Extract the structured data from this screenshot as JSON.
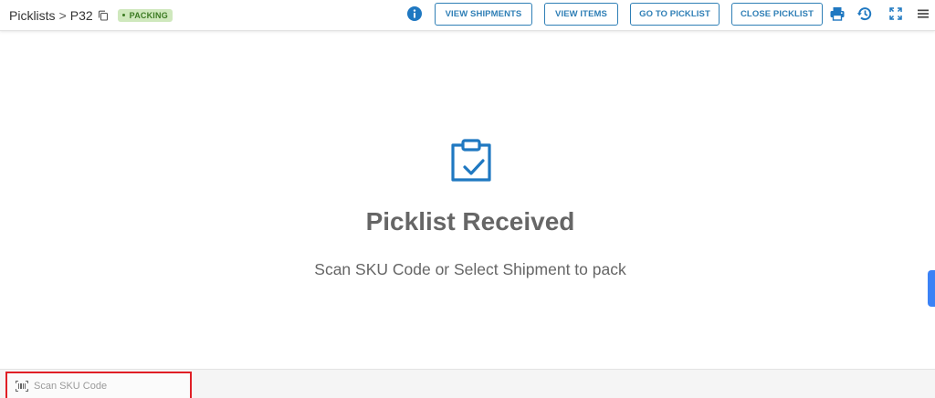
{
  "breadcrumb": {
    "root": "Picklists",
    "separator": ">",
    "current": "P32"
  },
  "status_badge": "PACKING",
  "toolbar": {
    "view_shipments": "VIEW SHIPMENTS",
    "view_items": "VIEW ITEMS",
    "go_to_picklist": "GO TO PICKLIST",
    "close_picklist": "CLOSE PICKLIST",
    "icons": [
      "info-icon",
      "print-icon",
      "history-icon",
      "fullscreen-icon",
      "menu-icon"
    ]
  },
  "main": {
    "icon": "clipboard-check-icon",
    "heading": "Picklist Received",
    "subtext": "Scan SKU Code or Select Shipment to pack"
  },
  "footer": {
    "scan_placeholder": "Scan SKU Code",
    "scan_icon": "barcode-icon"
  },
  "colors": {
    "accent": "#2f7fb6",
    "badge_bg": "#cfe8bd",
    "badge_text": "#3b7a22",
    "highlight": "#e01f26",
    "side_tab": "#3b82f6"
  }
}
